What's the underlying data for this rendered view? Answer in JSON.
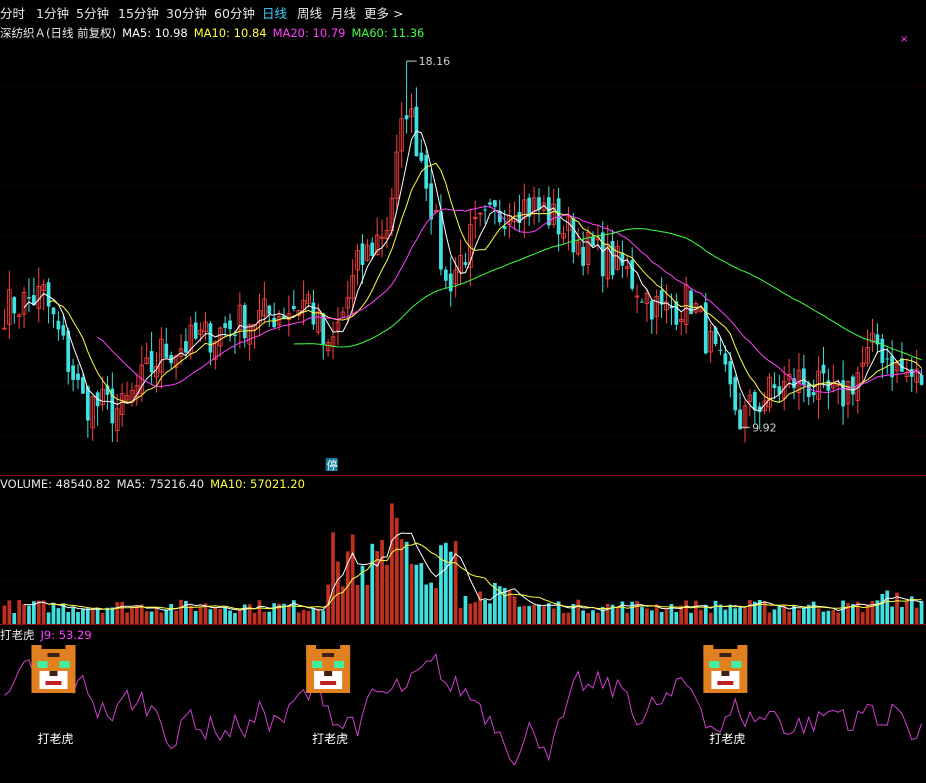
{
  "toolbar": {
    "tabs": [
      {
        "label": "分时",
        "active": false
      },
      {
        "label": "1分钟",
        "active": false
      },
      {
        "label": "5分钟",
        "active": false
      },
      {
        "label": "15分钟",
        "active": false
      },
      {
        "label": "30分钟",
        "active": false
      },
      {
        "label": "60分钟",
        "active": false
      },
      {
        "label": "日线",
        "active": true
      },
      {
        "label": "周线",
        "active": false
      },
      {
        "label": "月线",
        "active": false
      },
      {
        "label": "更多 >",
        "active": false
      }
    ]
  },
  "price_panel": {
    "title": "深纺织Ａ(日线 前复权)",
    "ma5": "MA5: 10.98",
    "ma10": "MA10: 10.84",
    "ma20": "MA20: 10.79",
    "ma60": "MA60: 11.36",
    "high_label": "18.16",
    "low_label": "9.92",
    "limit_badge": "停",
    "close_mark": "×",
    "colors": {
      "up": "#ff4040",
      "down": "#40e0e0",
      "ma5": "#ffffff",
      "ma10": "#ffff40",
      "ma20": "#ff40ff",
      "ma60": "#40ff40"
    }
  },
  "volume_panel": {
    "title": "VOLUME: 48540.82",
    "ma5": "MA5: 75216.40",
    "ma10": "MA10: 57021.20"
  },
  "indicator_panel": {
    "title": "打老虎",
    "j9": "J9: 53.29",
    "tiger_labels": [
      "打老虎",
      "打老虎",
      "打老虎"
    ]
  },
  "chart_data": {
    "type": "candlestick",
    "price_range": [
      9.5,
      18.5
    ],
    "high": 18.16,
    "low": 9.92,
    "close_series_keypoints": [
      [
        0,
        12.6
      ],
      [
        8,
        12.9
      ],
      [
        16,
        10.5
      ],
      [
        24,
        10.3
      ],
      [
        32,
        11.6
      ],
      [
        40,
        11.9
      ],
      [
        48,
        12.3
      ],
      [
        56,
        12.5
      ],
      [
        62,
        12.8
      ],
      [
        66,
        11.5
      ],
      [
        72,
        13.5
      ],
      [
        78,
        14.5
      ],
      [
        82,
        17.2
      ],
      [
        86,
        15.6
      ],
      [
        90,
        13.1
      ],
      [
        96,
        14.3
      ],
      [
        104,
        15.0
      ],
      [
        110,
        14.8
      ],
      [
        118,
        14.0
      ],
      [
        126,
        13.5
      ],
      [
        134,
        12.5
      ],
      [
        140,
        12.8
      ],
      [
        146,
        11.2
      ],
      [
        150,
        10.1
      ],
      [
        156,
        10.7
      ],
      [
        162,
        11.0
      ],
      [
        170,
        10.5
      ],
      [
        178,
        11.8
      ],
      [
        182,
        11.2
      ],
      [
        186,
        11.0
      ]
    ],
    "volume_range": [
      0,
      260000
    ],
    "j9_range": [
      -10,
      110
    ],
    "tiger_positions": [
      10,
      66,
      147
    ]
  }
}
